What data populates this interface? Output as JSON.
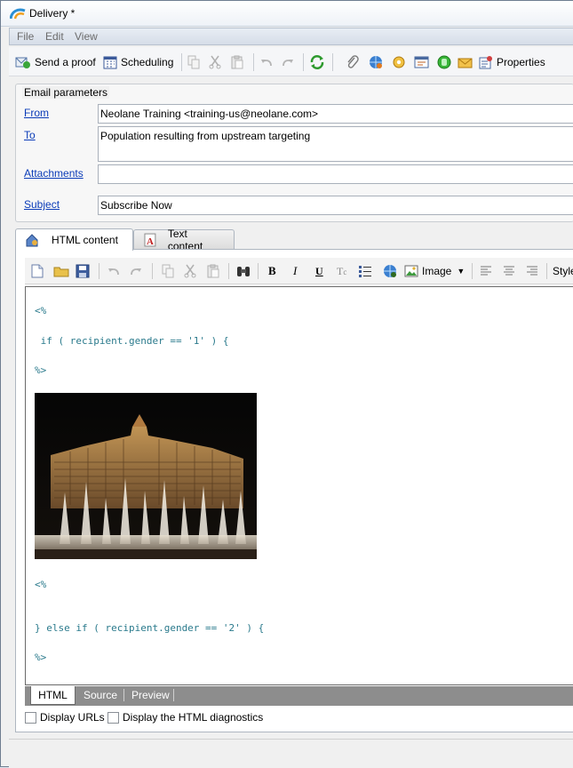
{
  "window": {
    "title": "Delivery *"
  },
  "menu": [
    "File",
    "Edit",
    "View"
  ],
  "toolbar": {
    "send_proof": "Send a proof",
    "scheduling": "Scheduling",
    "properties": "Properties"
  },
  "params": {
    "legend": "Email parameters",
    "from_label": "From",
    "from_value": "Neolane Training <training-us@neolane.com>",
    "to_label": "To",
    "to_value": "Population resulting from upstream targeting",
    "attachments_label": "Attachments",
    "attachments_value": "",
    "subject_label": "Subject",
    "subject_value": "Subscribe Now"
  },
  "tabs": [
    "HTML content",
    "Text content"
  ],
  "editor_toolbar": {
    "image_label": "Image",
    "style_label": "Style"
  },
  "editor": {
    "lines": [
      "<%",
      " if ( recipient.gender == '1' ) {",
      "%>",
      "<%",
      "} else if ( recipient.gender == '2' ) {",
      "%>"
    ]
  },
  "view_tabs": [
    "HTML",
    "Source",
    "Preview"
  ],
  "options": {
    "display_urls": "Display URLs",
    "html_diagnostics": "Display the HTML diagnostics"
  },
  "colors": {
    "link": "#0b3cb8",
    "code": "#2a7a8c"
  }
}
